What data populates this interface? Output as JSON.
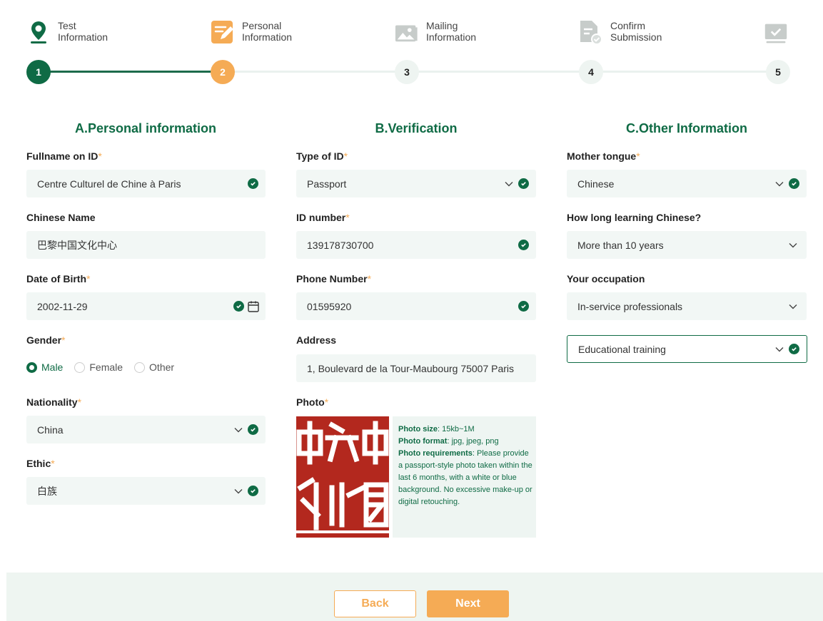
{
  "steps": [
    {
      "number": "1",
      "line1": "Test",
      "line2": "Information",
      "icon": "map-pin-icon",
      "state": "done"
    },
    {
      "number": "2",
      "line1": "Personal",
      "line2": "Information",
      "icon": "edit-form-icon",
      "state": "active"
    },
    {
      "number": "3",
      "line1": "Mailing",
      "line2": "Information",
      "icon": "image-icon",
      "state": "todo"
    },
    {
      "number": "4",
      "line1": "Confirm",
      "line2": "Submission",
      "icon": "document-check-icon",
      "state": "todo"
    },
    {
      "number": "5",
      "line1": "",
      "line2": "",
      "icon": "monitor-check-icon",
      "state": "todo"
    }
  ],
  "colors": {
    "primary": "#0f6b45",
    "accent": "#f5ab55",
    "field_bg": "#f2f7f5"
  },
  "sectionA": {
    "title": "A.Personal information",
    "fullname": {
      "label": "Fullname on ID",
      "value": "Centre Culturel de Chine à Paris"
    },
    "chinese_name": {
      "label": "Chinese Name",
      "value": "巴黎中国文化中心"
    },
    "dob": {
      "label": "Date of Birth",
      "value": "2002-11-29"
    },
    "gender": {
      "label": "Gender",
      "options": [
        "Male",
        "Female",
        "Other"
      ],
      "selected": "Male"
    },
    "nationality": {
      "label": "Nationality",
      "value": "China"
    },
    "ethic": {
      "label": "Ethic",
      "value": "白族"
    }
  },
  "sectionB": {
    "title": "B.Verification",
    "id_type": {
      "label": "Type of ID",
      "value": "Passport"
    },
    "id_number": {
      "label": "ID number",
      "value": "139178730700"
    },
    "phone": {
      "label": "Phone Number",
      "value": "01595920"
    },
    "address": {
      "label": "Address",
      "value": "1, Boulevard de la Tour-Maubourg 75007 Paris"
    },
    "photo": {
      "label": "Photo",
      "size_label": "Photo size",
      "size_value": ": 15kb~1M",
      "format_label": "Photo format",
      "format_value": ": jpg, jpeg, png",
      "req_label": "Photo requirements",
      "req_value": ": Please provide a passport-style photo taken within the last 6 months, with a white or blue background. No excessive make-up or digital retouching."
    }
  },
  "sectionC": {
    "title": "C.Other Information",
    "mother_tongue": {
      "label": "Mother tongue",
      "value": "Chinese"
    },
    "learning": {
      "label": "How long learning Chinese?",
      "value": "More than 10 years"
    },
    "occupation": {
      "label": "Your occupation",
      "value": "In-service professionals",
      "sub_value": "Educational training"
    }
  },
  "required_mark": "*",
  "buttons": {
    "back": "Back",
    "next": "Next"
  }
}
